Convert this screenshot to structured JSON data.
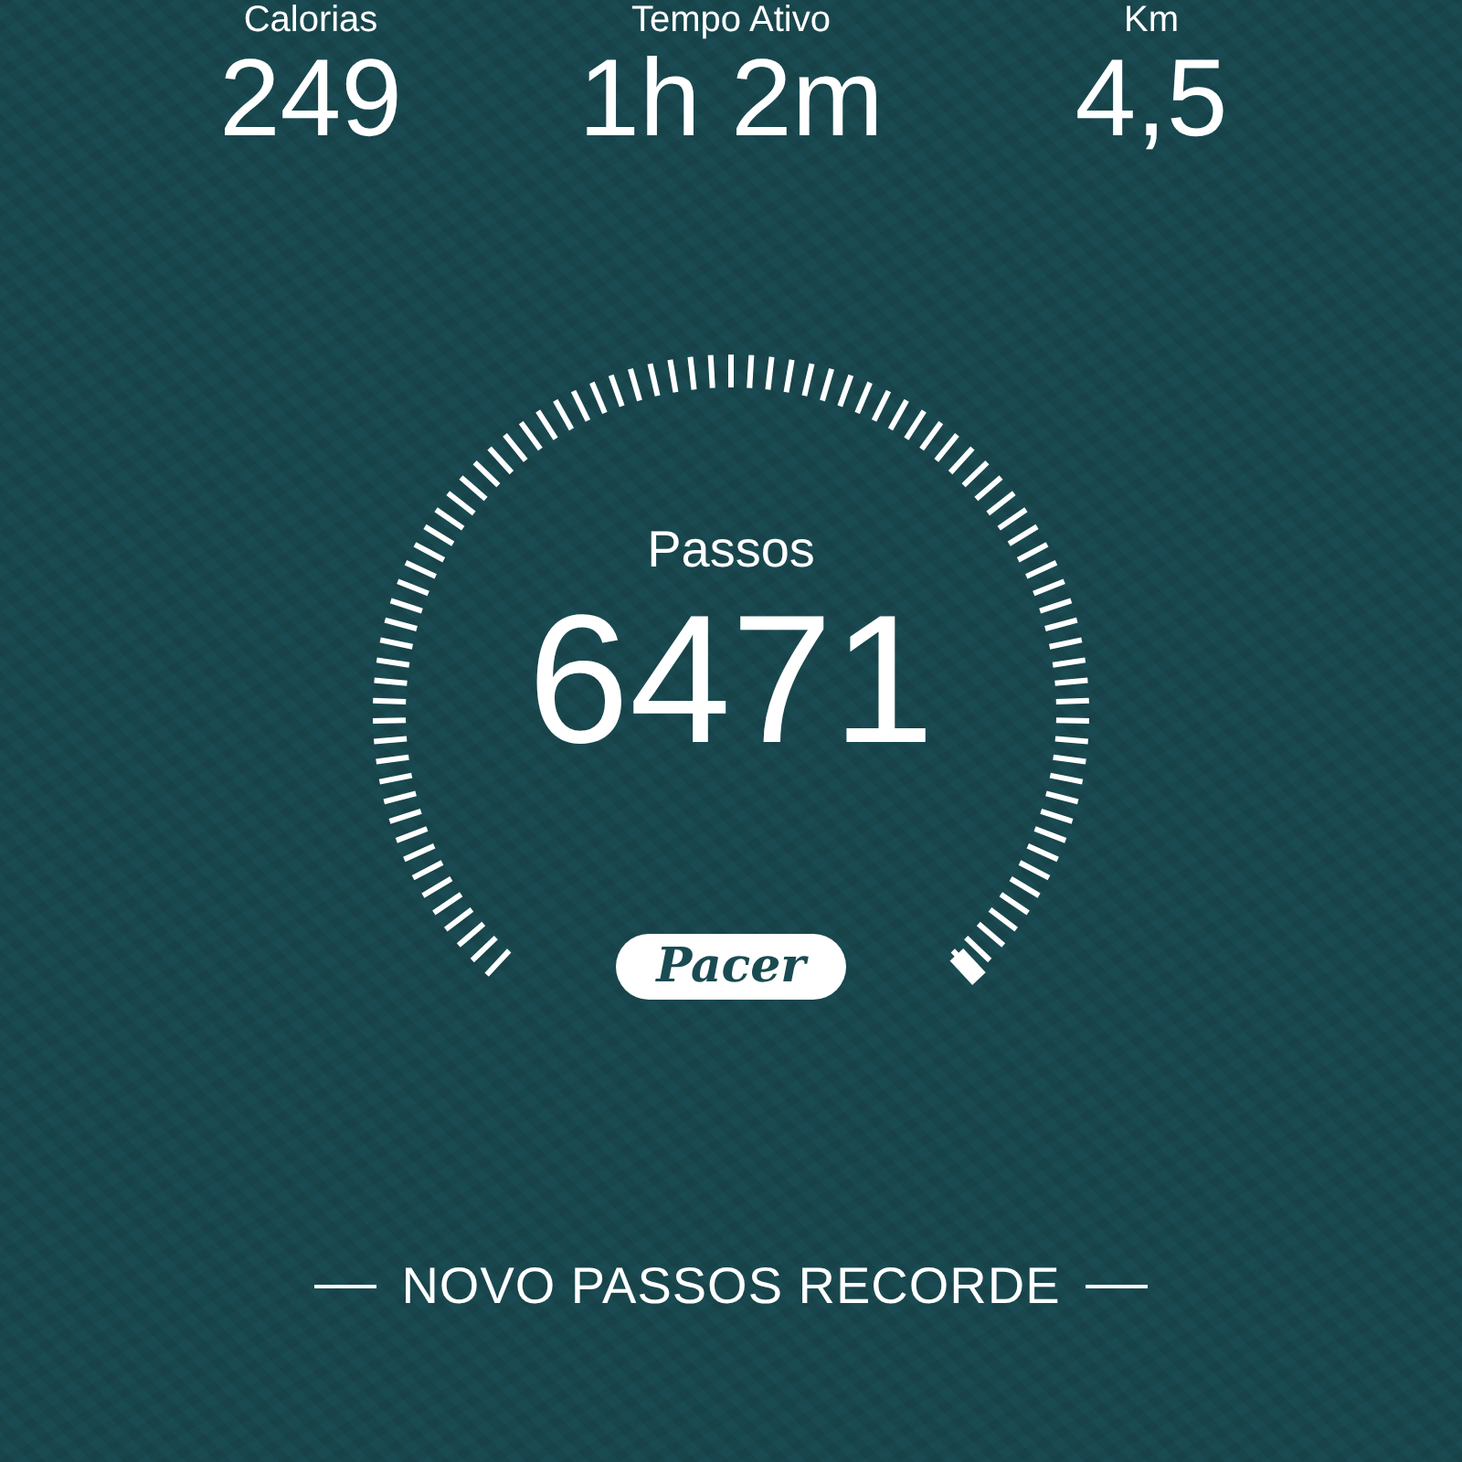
{
  "stats": [
    {
      "label": "Calorias",
      "value": "249"
    },
    {
      "label": "Tempo Ativo",
      "value": "1h 2m"
    },
    {
      "label": "Km",
      "value": "4,5"
    }
  ],
  "gauge": {
    "title": "Passos",
    "value": "6471",
    "brand": "Pacer"
  },
  "record_banner": "NOVO PASSOS RECORDE"
}
